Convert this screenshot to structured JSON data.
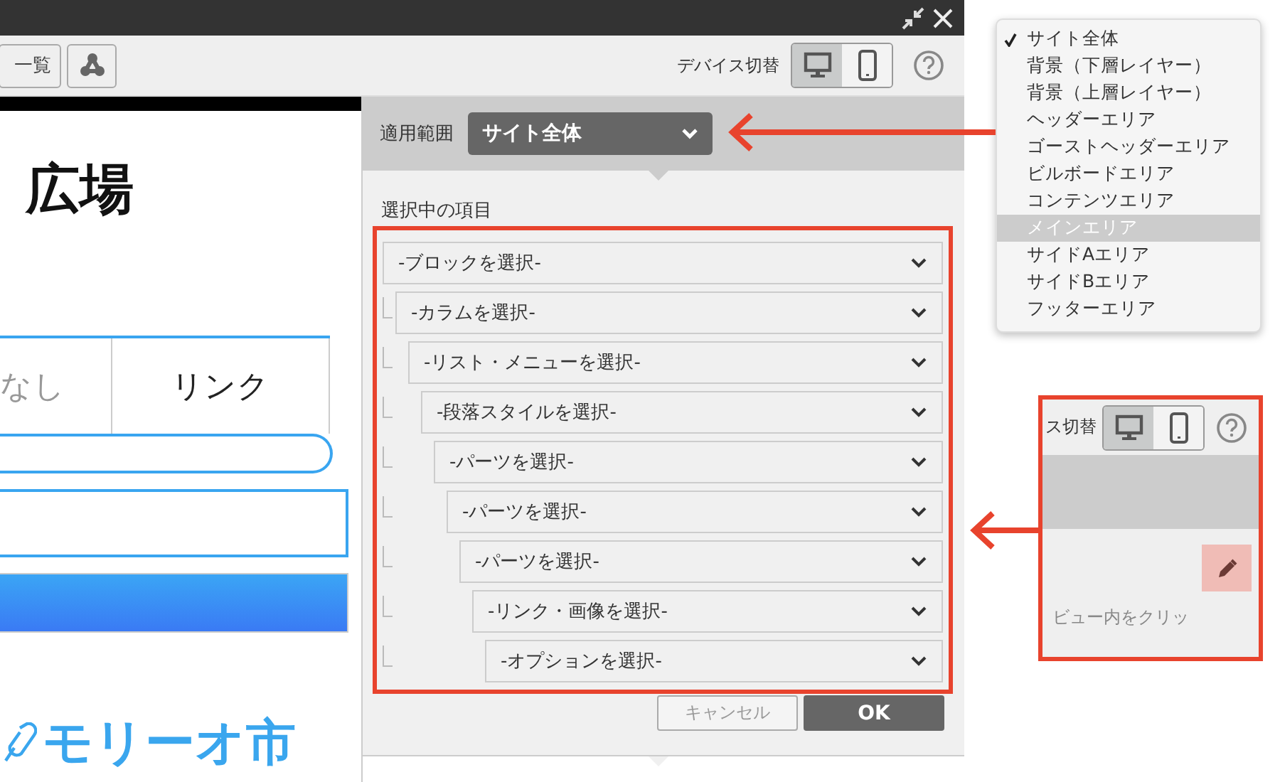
{
  "toolbar": {
    "list_button": "一覧",
    "device_label": "デバイス切替",
    "devices": [
      {
        "kind": "desktop",
        "selected": true
      },
      {
        "kind": "mobile",
        "selected": false
      }
    ]
  },
  "preview": {
    "heading": "広場",
    "tabs": [
      {
        "label": "なし",
        "selected": false
      },
      {
        "label": "リンク",
        "selected": true
      }
    ],
    "logo_text": "モリーオ市"
  },
  "scope": {
    "label": "適用範囲",
    "value": "サイト全体"
  },
  "selection": {
    "title": "選択中の項目",
    "items": [
      {
        "label": "-ブロックを選択-",
        "children": [
          {
            "label": "-カラムを選択-",
            "children": [
              {
                "label": "-リスト・メニューを選択-",
                "children": [
                  {
                    "label": "-段落スタイルを選択-",
                    "children": [
                      {
                        "label": "-パーツを選択-",
                        "children": [
                          {
                            "label": "-パーツを選択-",
                            "children": [
                              {
                                "label": "-パーツを選択-",
                                "children": [
                                  {
                                    "label": "-リンク・画像を選択-",
                                    "children": [
                                      {
                                        "label": "-オプションを選択-"
                                      }
                                    ]
                                  }
                                ]
                              }
                            ]
                          }
                        ]
                      }
                    ]
                  }
                ]
              }
            ]
          }
        ]
      }
    ]
  },
  "buttons": [
    {
      "label": "キャンセル",
      "kind": "secondary"
    },
    {
      "label": "OK",
      "kind": "primary"
    }
  ],
  "scope_menu": {
    "items": [
      {
        "label": "サイト全体",
        "checked": true,
        "selected": false
      },
      {
        "label": "背景（下層レイヤー）",
        "checked": false,
        "selected": false
      },
      {
        "label": "背景（上層レイヤー）",
        "checked": false,
        "selected": false
      },
      {
        "label": "ヘッダーエリア",
        "checked": false,
        "selected": false
      },
      {
        "label": "ゴーストヘッダーエリア",
        "checked": false,
        "selected": false
      },
      {
        "label": "ビルボードエリア",
        "checked": false,
        "selected": false
      },
      {
        "label": "コンテンツエリア",
        "checked": false,
        "selected": false
      },
      {
        "label": "メインエリア",
        "checked": false,
        "selected": true
      },
      {
        "label": "サイドAエリア",
        "checked": false,
        "selected": false
      },
      {
        "label": "サイドBエリア",
        "checked": false,
        "selected": false
      },
      {
        "label": "フッターエリア",
        "checked": false,
        "selected": false
      }
    ]
  },
  "inset": {
    "device_label": "ス切替",
    "devices": [
      {
        "kind": "desktop",
        "selected": true
      },
      {
        "kind": "mobile",
        "selected": false
      }
    ],
    "hint": "ビュー内をクリッ"
  }
}
